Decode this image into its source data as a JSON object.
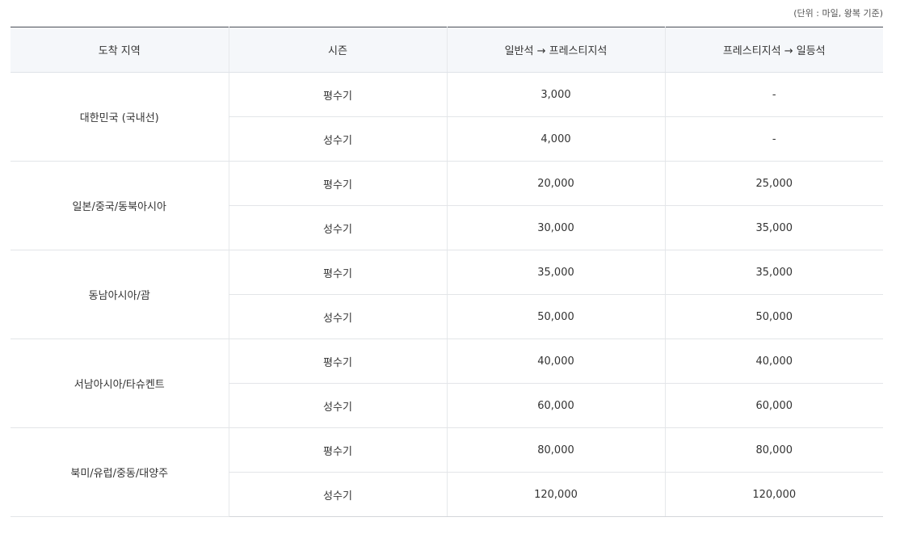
{
  "unit_note": "(단위 : 마일, 왕복 기준)",
  "table": {
    "headers": {
      "region": "도착 지역",
      "season": "시즌",
      "economy_to_prestige": "일반석 → 프레스티지석",
      "prestige_to_first": "프레스티지석 → 일등석"
    },
    "rows": [
      {
        "region": "대한민국 (국내선)",
        "off_peak": {
          "season": "평수기",
          "economy_to_prestige": "3,000",
          "prestige_to_first": "-"
        },
        "peak": {
          "season": "성수기",
          "economy_to_prestige": "4,000",
          "prestige_to_first": "-"
        }
      },
      {
        "region": "일본/중국/동북아시아",
        "off_peak": {
          "season": "평수기",
          "economy_to_prestige": "20,000",
          "prestige_to_first": "25,000"
        },
        "peak": {
          "season": "성수기",
          "economy_to_prestige": "30,000",
          "prestige_to_first": "35,000"
        }
      },
      {
        "region": "동남아시아/괌",
        "off_peak": {
          "season": "평수기",
          "economy_to_prestige": "35,000",
          "prestige_to_first": "35,000"
        },
        "peak": {
          "season": "성수기",
          "economy_to_prestige": "50,000",
          "prestige_to_first": "50,000"
        }
      },
      {
        "region": "서남아시아/타슈켄트",
        "off_peak": {
          "season": "평수기",
          "economy_to_prestige": "40,000",
          "prestige_to_first": "40,000"
        },
        "peak": {
          "season": "성수기",
          "economy_to_prestige": "60,000",
          "prestige_to_first": "60,000"
        }
      },
      {
        "region": "북미/유럽/중동/대양주",
        "off_peak": {
          "season": "평수기",
          "economy_to_prestige": "80,000",
          "prestige_to_first": "80,000"
        },
        "peak": {
          "season": "성수기",
          "economy_to_prestige": "120,000",
          "prestige_to_first": "120,000"
        }
      }
    ]
  }
}
